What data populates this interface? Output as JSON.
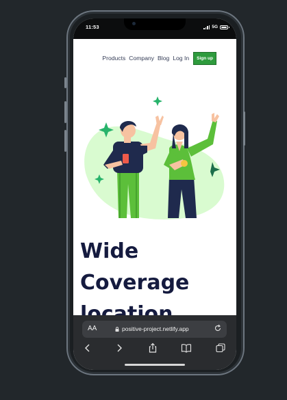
{
  "status": {
    "time": "11:53",
    "network": "5G"
  },
  "nav": {
    "links": [
      "Products",
      "Company",
      "Blog",
      "Log In"
    ],
    "signup_label": "Sign up"
  },
  "hero": {
    "headline_lines": [
      "Wide",
      "Coverage",
      "location"
    ]
  },
  "browser": {
    "aa_label": "AA",
    "url": "positive-project.netlify.app"
  },
  "colors": {
    "accent": "#2e9b3d",
    "headline": "#151b3f",
    "blob": "#d9fbd0"
  },
  "icons": [
    "signal-icon",
    "battery-icon",
    "lock-icon",
    "reload-icon",
    "back-icon",
    "forward-icon",
    "share-icon",
    "bookmarks-icon",
    "tabs-icon"
  ]
}
